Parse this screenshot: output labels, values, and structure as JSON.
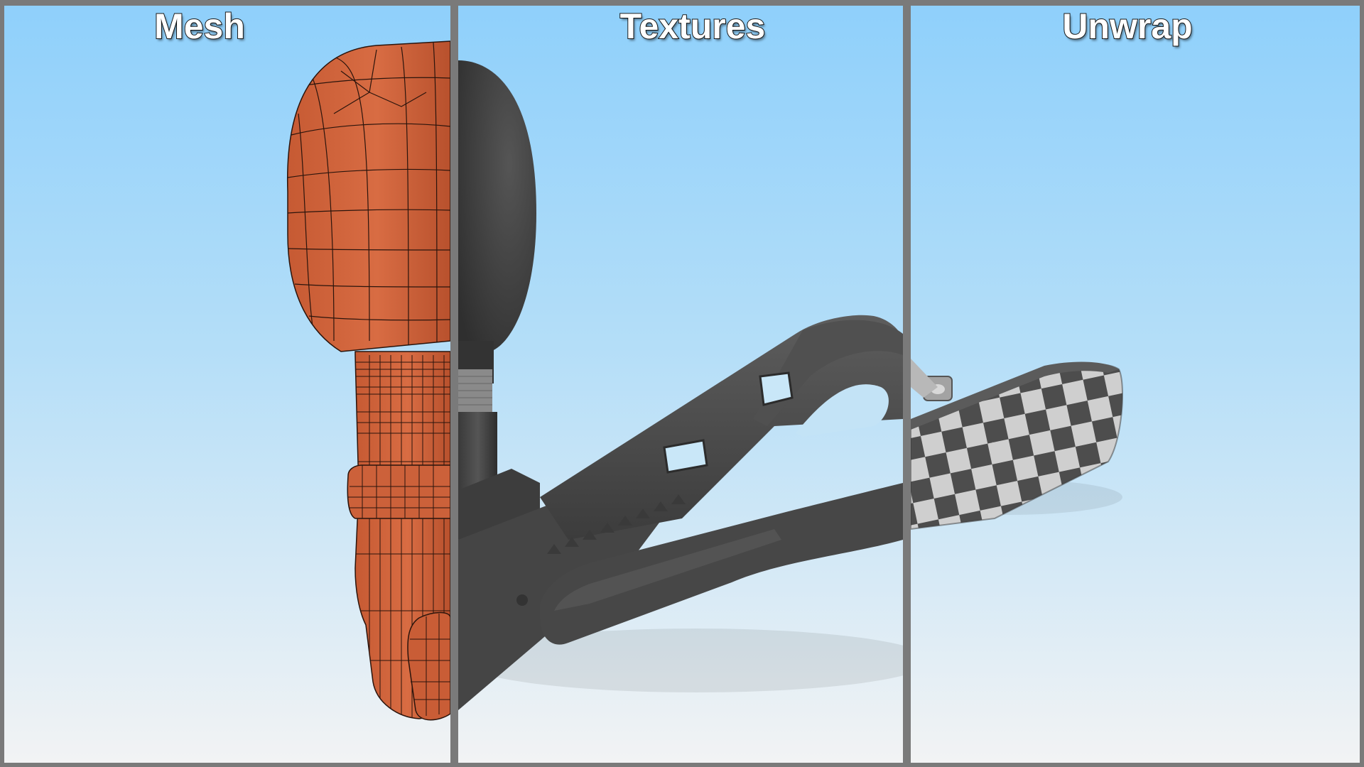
{
  "panels": [
    {
      "id": "mesh",
      "title": "Mesh",
      "render_style": "orange wireframe mesh"
    },
    {
      "id": "textures",
      "title": "Textures",
      "render_style": "dark grey textured"
    },
    {
      "id": "unwrap",
      "title": "Unwrap",
      "render_style": "grey and white checker UV"
    }
  ],
  "colors": {
    "sky_top": "#8fd0fb",
    "sky_mid": "#bfe3f7",
    "sky_bottom": "#f1f3f4",
    "divider": "#7a7a7a",
    "mesh_orange": "#d4673f",
    "mesh_orange_dark": "#b24f2c",
    "wire": "#2a140c",
    "plastic_dark": "#4a4a4a",
    "plastic_mid": "#5c5c5c",
    "foam": "#3b3b3b",
    "checker_light": "#cfcfcf",
    "checker_dark": "#4d4d4d"
  }
}
